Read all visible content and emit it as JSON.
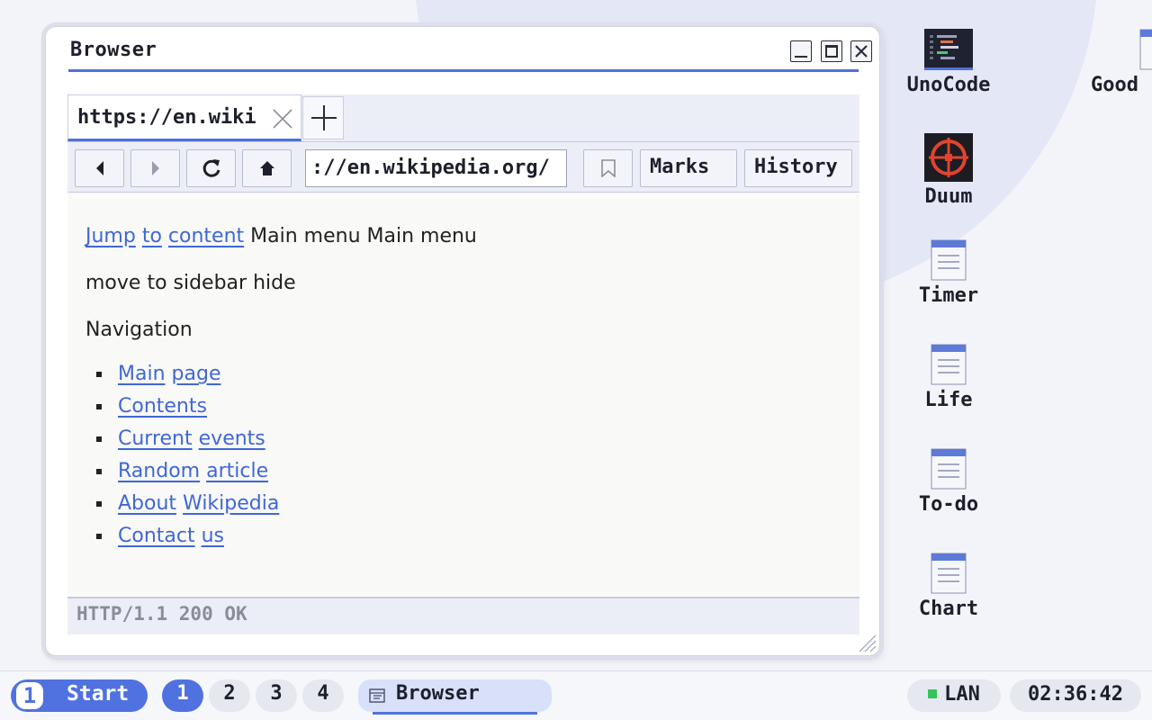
{
  "window": {
    "title": "Browser",
    "tab": {
      "label": "https://en.wiki"
    },
    "url": "://en.wikipedia.org/",
    "buttons": {
      "marks": "Marks",
      "history": "History"
    },
    "status": "HTTP/1.1 200 OK"
  },
  "content": {
    "line1": {
      "link_jump": "Jump",
      "link_to": "to",
      "link_content": "content",
      "text": "Main menu Main menu"
    },
    "line2": "move to sidebar hide",
    "line3": "Navigation",
    "nav": [
      {
        "w1": "Main",
        "w2": "page"
      },
      {
        "w1": "Contents",
        "w2": ""
      },
      {
        "w1": "Current",
        "w2": "events"
      },
      {
        "w1": "Random",
        "w2": "article"
      },
      {
        "w1": "About",
        "w2": "Wikipedia"
      },
      {
        "w1": "Contact",
        "w2": "us"
      }
    ]
  },
  "desktop_icons": [
    {
      "label": "UnoCode",
      "icon": "code-editor-icon"
    },
    {
      "label": "Good",
      "icon": "document-icon"
    },
    {
      "label": "Duum",
      "icon": "crosshair-game-icon"
    },
    {
      "label": "Timer",
      "icon": "document-icon"
    },
    {
      "label": "Life",
      "icon": "document-icon"
    },
    {
      "label": "To-do",
      "icon": "document-icon"
    },
    {
      "label": "Chart",
      "icon": "document-icon"
    }
  ],
  "taskbar": {
    "start_number": "1",
    "start_label": "Start",
    "workspaces": [
      "1",
      "2",
      "3",
      "4"
    ],
    "task_label": "Browser",
    "network": "LAN",
    "clock": "02:36:42"
  },
  "colors": {
    "accent": "#4f72e0",
    "link": "#3f67d6",
    "network_ok": "#37c45a"
  }
}
